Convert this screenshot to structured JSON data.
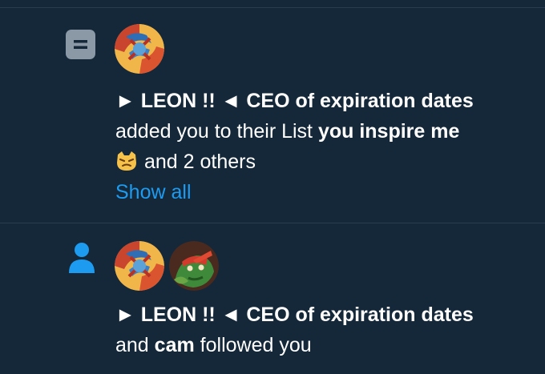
{
  "notifications": [
    {
      "type_icon": "list-icon",
      "actor_name": "► LEON !! ◄ CEO of expiration dates",
      "action_text": "added you to their List",
      "list_name": "you inspire me",
      "emoji": "cat-emoji",
      "others_text": "and 2 others",
      "show_all_label": "Show all",
      "avatars": [
        "leon-avatar"
      ]
    },
    {
      "type_icon": "person-icon",
      "actor_name": "► LEON !! ◄ CEO of expiration dates",
      "and_text": "and",
      "second_actor": "cam",
      "action_text": "followed you",
      "avatars": [
        "leon-avatar",
        "cam-avatar"
      ]
    }
  ],
  "colors": {
    "background": "#15283a",
    "divider": "#2a3d50",
    "link": "#1d9bf0",
    "list_icon": "#8b98a5",
    "follow_icon": "#1d9bf0"
  }
}
